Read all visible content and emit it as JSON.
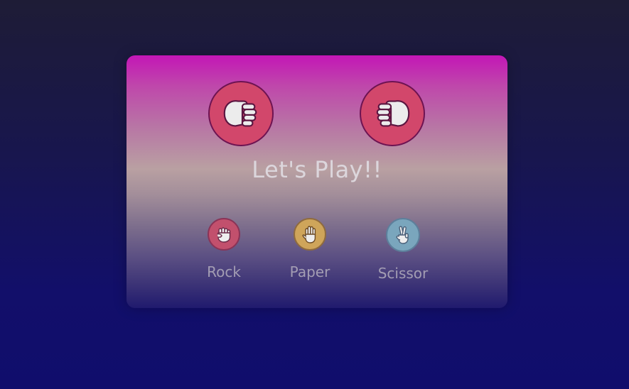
{
  "game": {
    "title": "Let's Play!!",
    "player_hand_icon": "fist-icon",
    "computer_hand_icon": "fist-icon",
    "choices": [
      {
        "label": "Rock",
        "icon": "rock-hand-icon",
        "color": "#c2506d"
      },
      {
        "label": "Paper",
        "icon": "paper-hand-icon",
        "color": "#cfa55a"
      },
      {
        "label": "Scissor",
        "icon": "scissor-hand-icon",
        "color": "#7aa6bd"
      }
    ]
  },
  "colors": {
    "background_top": "#1e1c36",
    "background_bottom": "#100d6c",
    "card_top": "#c316b6",
    "hand_circle": "#d2476b",
    "title_text": "#dcd6dc",
    "choice_label": "#a39db3"
  }
}
